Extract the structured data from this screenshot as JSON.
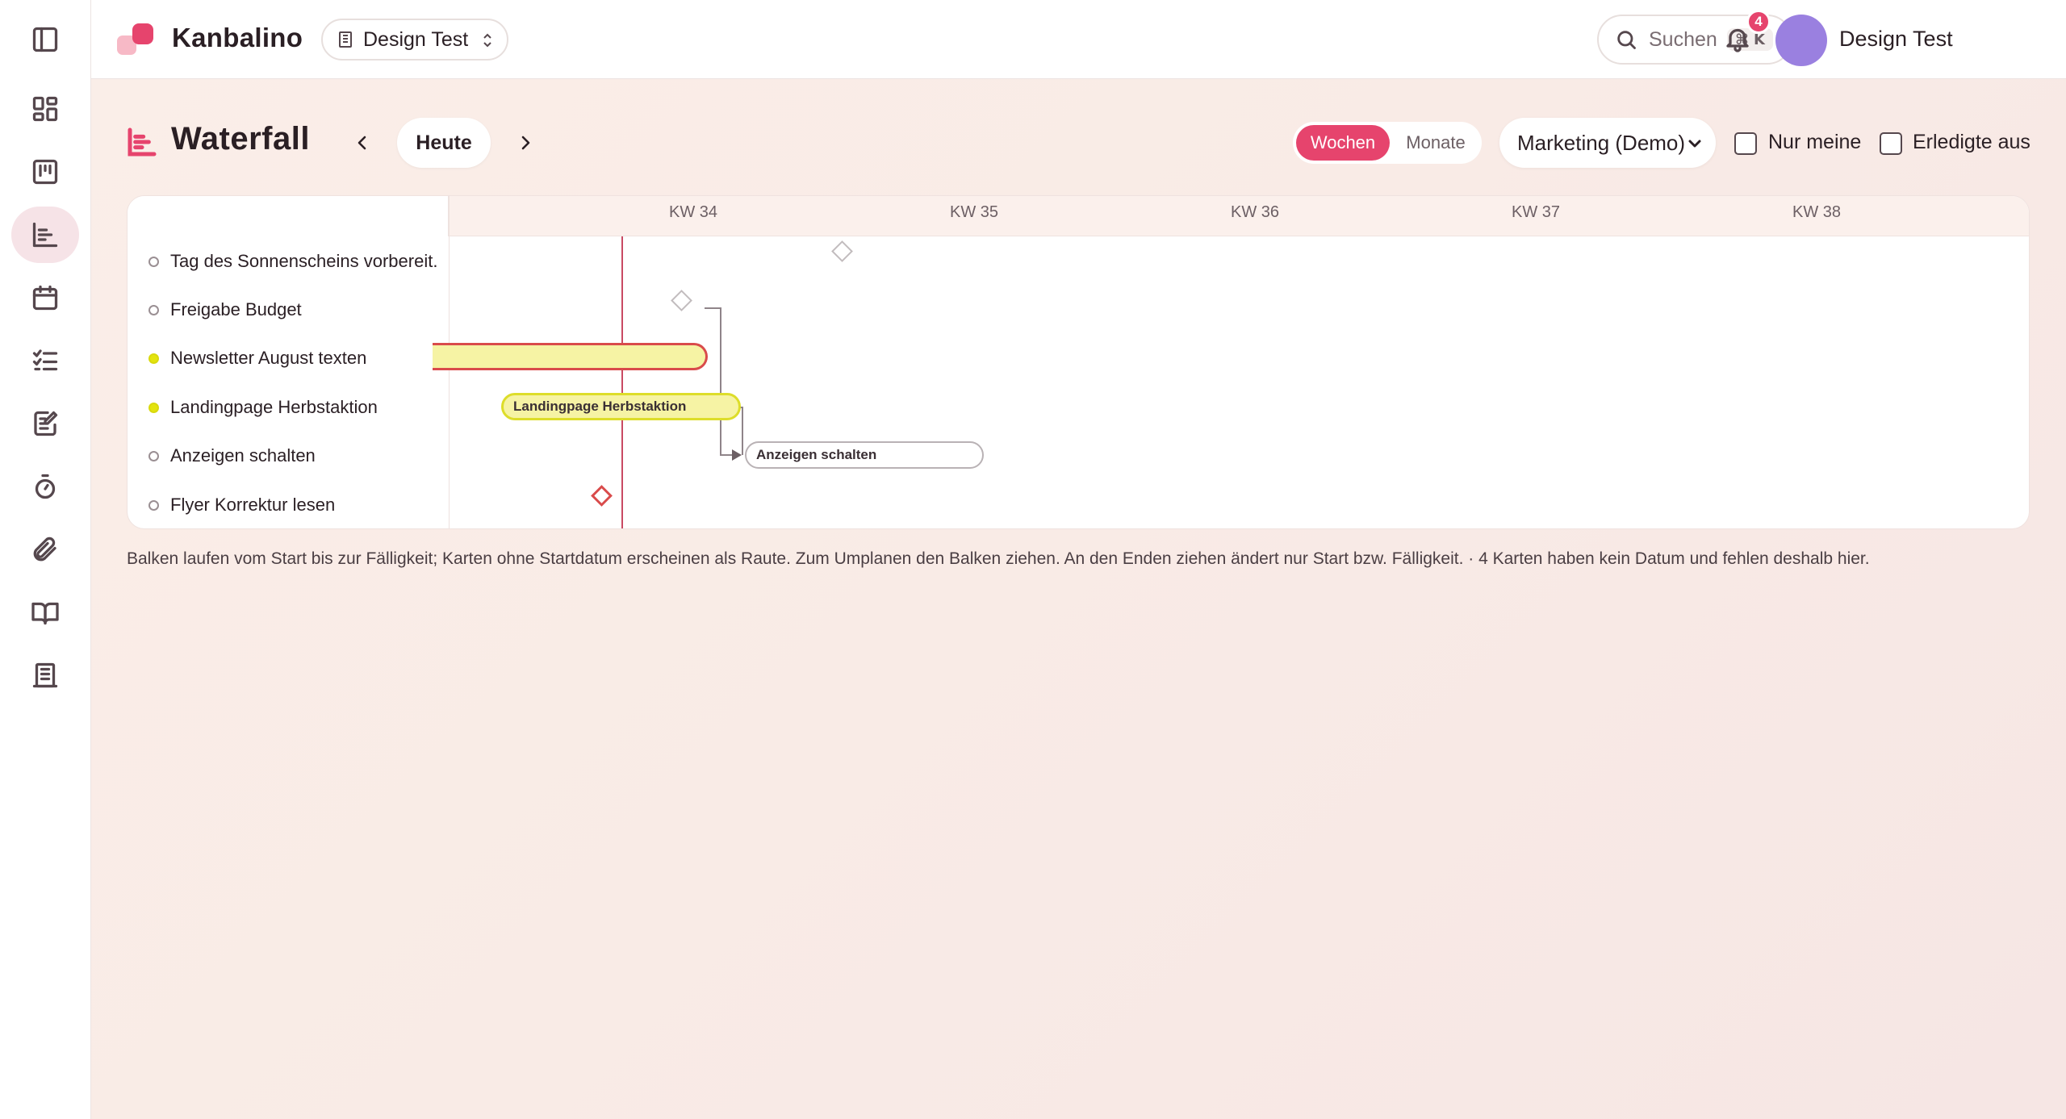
{
  "app": {
    "brand": "Kanbalino",
    "workspace": "Design Test",
    "search_label": "Suchen",
    "search_shortcut": "⌘ K",
    "notification_count": "4",
    "user_name": "Design Test"
  },
  "sidebar": {
    "items": [
      {
        "name": "sidebar-toggle",
        "icon": "panel-left-icon",
        "active": false
      },
      {
        "name": "dashboard",
        "icon": "grid-icon",
        "active": false
      },
      {
        "name": "board",
        "icon": "kanban-icon",
        "active": false
      },
      {
        "name": "waterfall",
        "icon": "waterfall-chart-icon",
        "active": true
      },
      {
        "name": "calendar",
        "icon": "calendar-icon",
        "active": false
      },
      {
        "name": "tasks",
        "icon": "checklist-icon",
        "active": false
      },
      {
        "name": "notes",
        "icon": "edit-note-icon",
        "active": false
      },
      {
        "name": "timer",
        "icon": "stopwatch-icon",
        "active": false
      },
      {
        "name": "attachments",
        "icon": "paperclip-icon",
        "active": false
      },
      {
        "name": "docs",
        "icon": "book-icon",
        "active": false
      },
      {
        "name": "organization",
        "icon": "building-icon",
        "active": false
      }
    ]
  },
  "page": {
    "title": "Waterfall",
    "today_button": "Heute",
    "view_toggle": {
      "active": "Wochen",
      "inactive": "Monate"
    },
    "board_select": "Marketing (Demo)",
    "filter_mine": "Nur meine",
    "filter_done": "Erledigte aus"
  },
  "gantt": {
    "weeks": [
      "KW 34",
      "KW 35",
      "KW 36",
      "KW 37",
      "KW 38"
    ],
    "rows": [
      {
        "label": "Tag des Sonnenscheins vorbereit...",
        "status": "open"
      },
      {
        "label": "Freigabe Budget",
        "status": "open"
      },
      {
        "label": "Newsletter August texten",
        "status": "in-progress"
      },
      {
        "label": "Landingpage Herbstaktion",
        "status": "in-progress"
      },
      {
        "label": "Anzeigen schalten",
        "status": "open"
      },
      {
        "label": "Flyer Korrektur lesen",
        "status": "open"
      }
    ],
    "bar_labels": {
      "landingpage": "Landingpage Herbstaktion",
      "anzeigen": "Anzeigen schalten"
    },
    "colors": {
      "accent": "#e6446d",
      "today_line": "#c94a63",
      "overdue": "#d94b4b",
      "in_progress_fill": "#f6f3a4",
      "in_progress_border": "#dddd2a"
    }
  },
  "caption": "Balken laufen vom Start bis zur Fälligkeit; Karten ohne Startdatum erscheinen als Raute. Zum Umplanen den Balken ziehen. An den Enden ziehen ändert nur Start bzw. Fälligkeit. · 4 Karten haben kein Datum und fehlen deshalb hier."
}
